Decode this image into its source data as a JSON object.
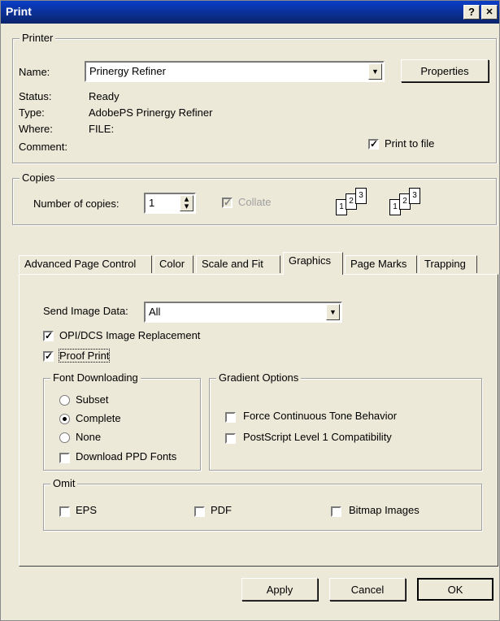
{
  "window": {
    "title": "Print",
    "help_label": "?",
    "close_label": "✕"
  },
  "printer": {
    "legend": "Printer",
    "name_label": "Name:",
    "name_value": "Prinergy Refiner",
    "properties_label": "Properties",
    "status_label": "Status:",
    "status_value": "Ready",
    "type_label": "Type:",
    "type_value": "AdobePS Prinergy Refiner",
    "where_label": "Where:",
    "where_value": "FILE:",
    "comment_label": "Comment:",
    "print_to_file_label": "Print to file",
    "print_to_file_checked": true
  },
  "copies": {
    "legend": "Copies",
    "number_label": "Number of copies:",
    "number_value": "1",
    "collate_label": "Collate",
    "collate_checked": true,
    "page_nums": [
      "1",
      "2",
      "3"
    ]
  },
  "tabs": [
    {
      "label": "Advanced Page Control",
      "active": false
    },
    {
      "label": "Color",
      "active": false
    },
    {
      "label": "Scale and Fit",
      "active": false
    },
    {
      "label": "Graphics",
      "active": true
    },
    {
      "label": "Page Marks",
      "active": false
    },
    {
      "label": "Trapping",
      "active": false
    }
  ],
  "graphics": {
    "send_image_label": "Send Image Data:",
    "send_image_value": "All",
    "opi_label": "OPI/DCS Image Replacement",
    "opi_checked": true,
    "proof_label": "Proof Print",
    "proof_checked": true,
    "font_downloading": {
      "legend": "Font Downloading",
      "subset": "Subset",
      "complete": "Complete",
      "none": "None",
      "selected": "complete",
      "download_ppd_label": "Download PPD Fonts",
      "download_ppd_checked": false
    },
    "gradient": {
      "legend": "Gradient Options",
      "force_label": "Force Continuous Tone Behavior",
      "force_checked": false,
      "ps1_label": "PostScript Level 1 Compatibility",
      "ps1_checked": false
    },
    "omit": {
      "legend": "Omit",
      "eps": "EPS",
      "eps_checked": false,
      "pdf": "PDF",
      "pdf_checked": false,
      "bitmap": "Bitmap Images",
      "bitmap_checked": false
    }
  },
  "buttons": {
    "apply": "Apply",
    "cancel": "Cancel",
    "ok": "OK"
  }
}
